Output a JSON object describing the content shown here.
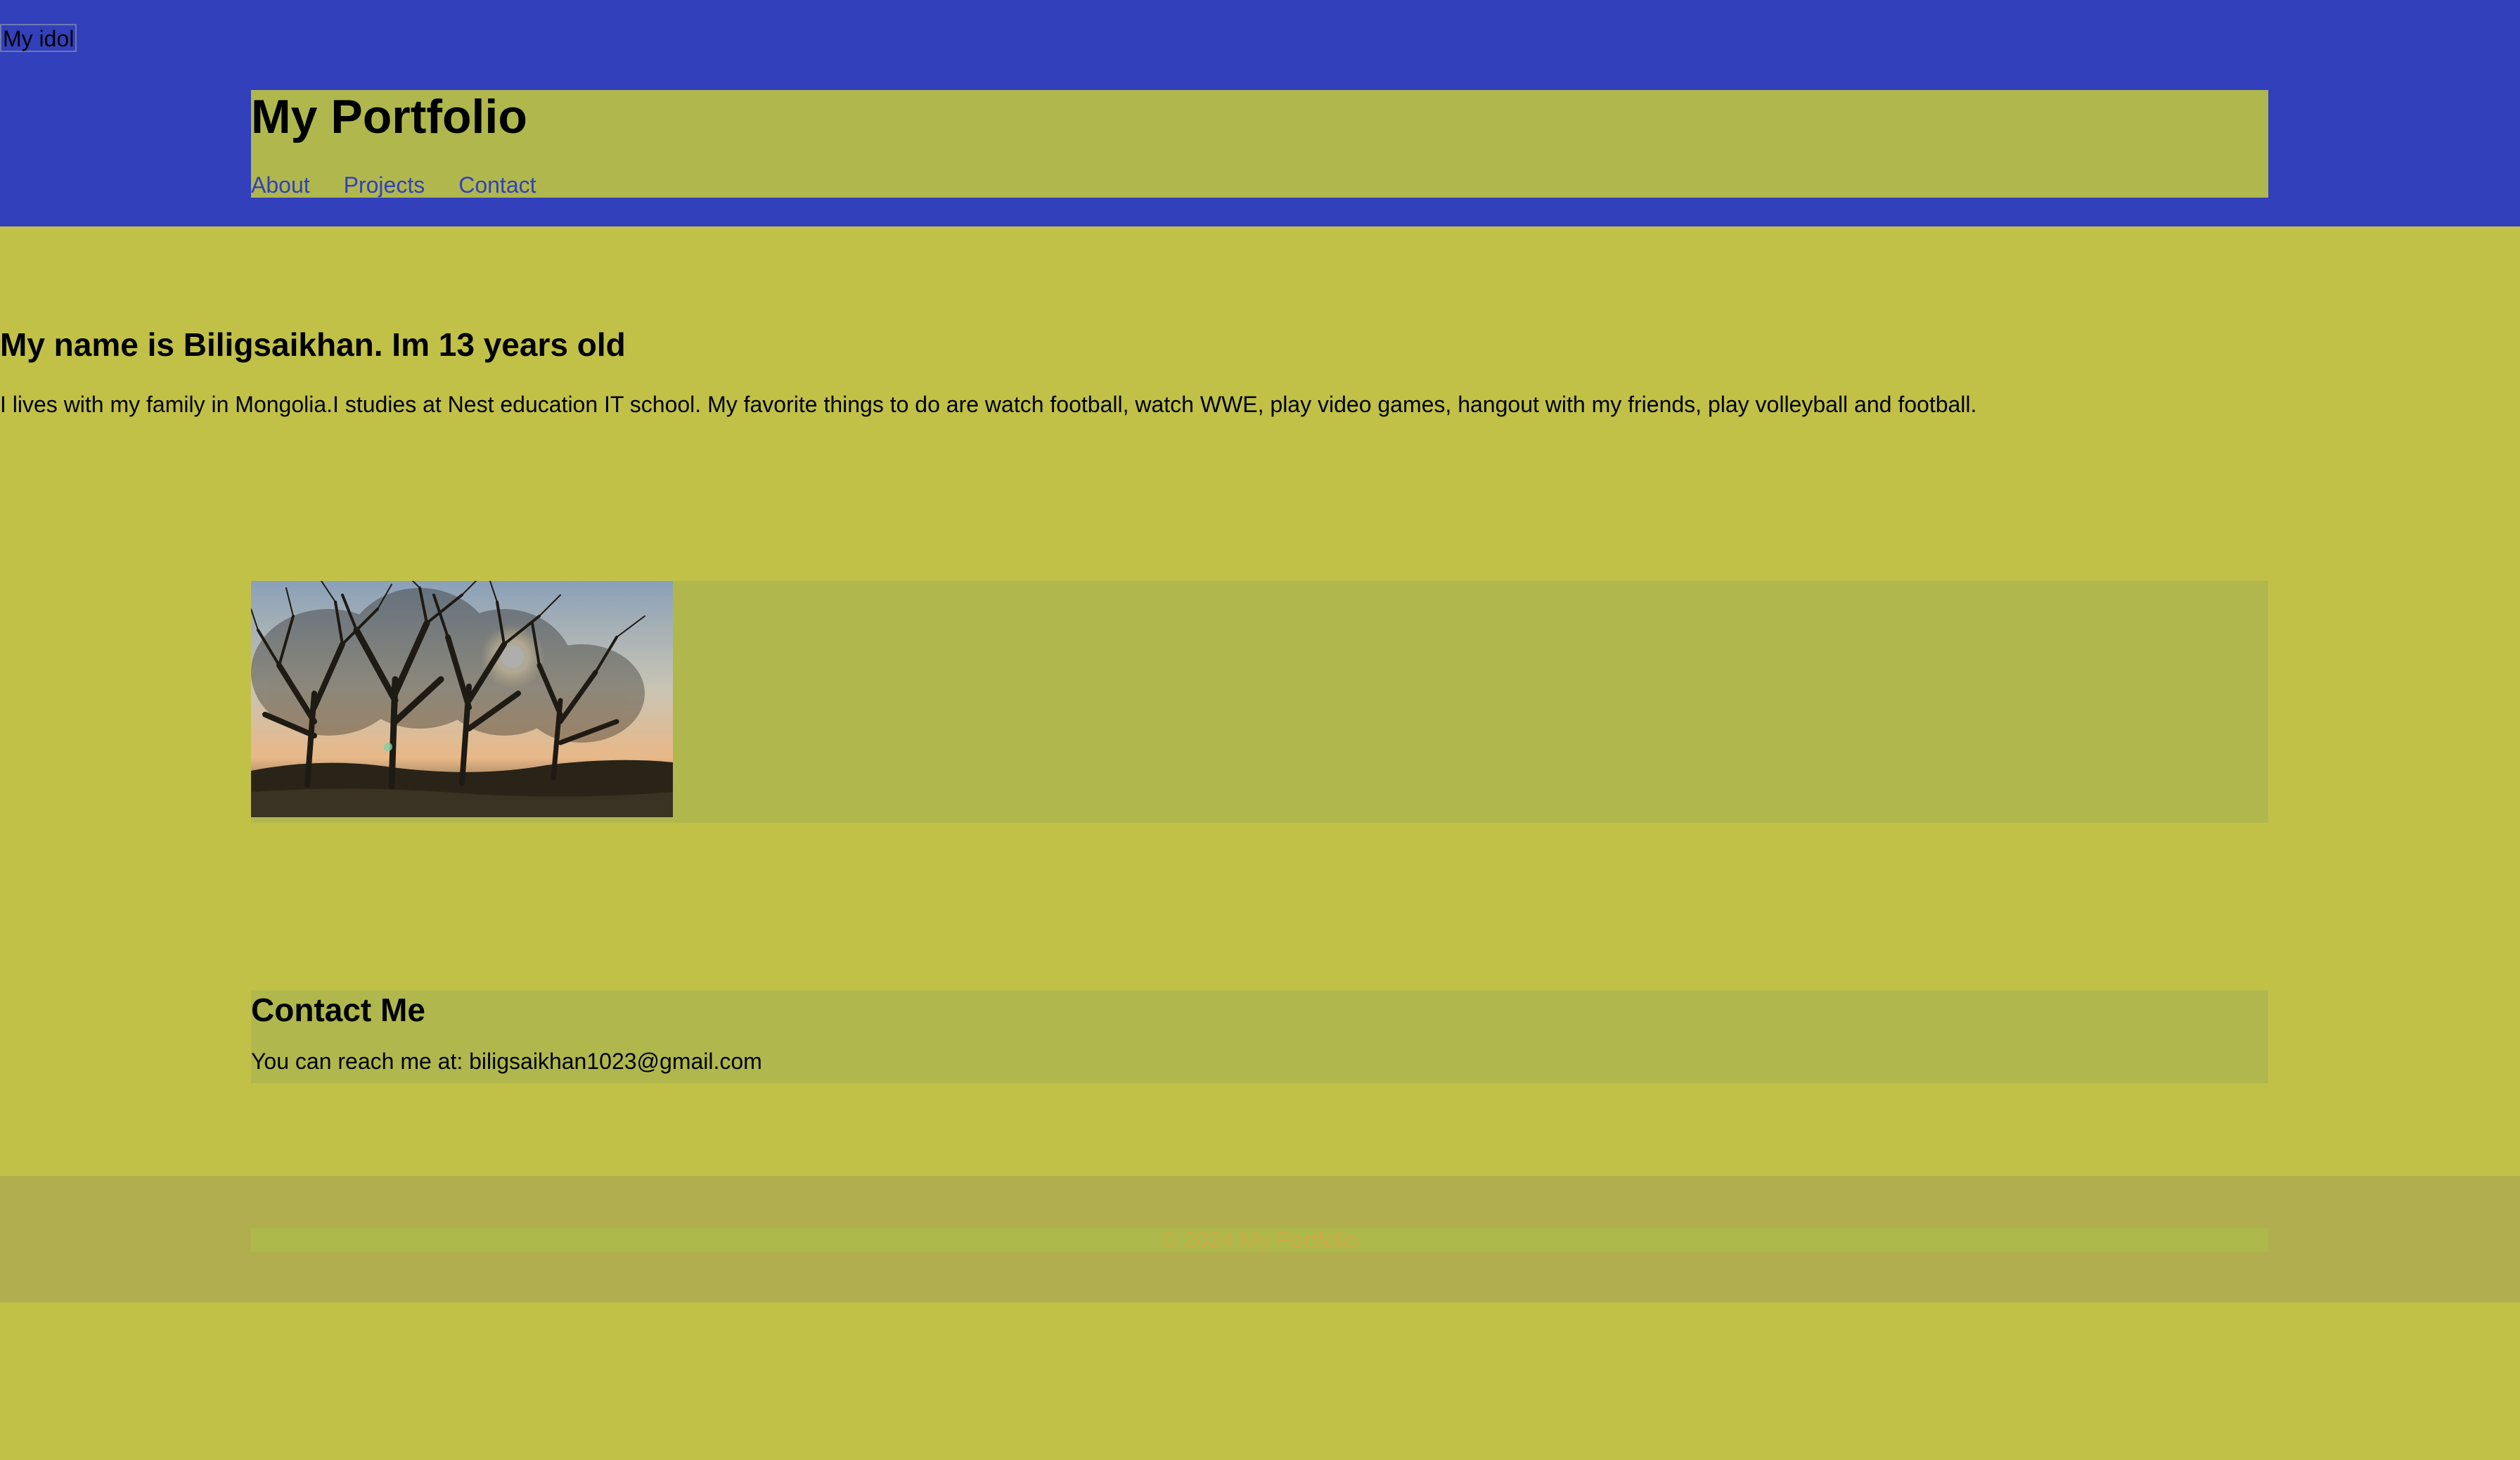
{
  "colors": {
    "page_background": "#c1c148",
    "top_bar": "#3240bc",
    "panel": "#b0b84d",
    "link": "#3240bc",
    "footer_background": "#b0ae4f",
    "footer_text": "#c9aa45"
  },
  "idol_button": {
    "label": "My idol"
  },
  "header": {
    "title": "My Portfolio",
    "nav": [
      {
        "label": "About"
      },
      {
        "label": "Projects"
      },
      {
        "label": "Contact"
      }
    ]
  },
  "intro": {
    "heading": "My name is Biligsaikhan. Im 13 years old",
    "text": "I lives with my family in Mongolia.I studies at Nest education IT school. My favorite things to do are watch football, watch WWE, play video games, hangout with my friends, play volleyball and football."
  },
  "gallery": {
    "image_description": "tree-silhouette-sunset-photo"
  },
  "contact": {
    "heading": "Contact Me",
    "text": "You can reach me at: biligsaikhan1023@gmail.com"
  },
  "footer": {
    "text": "© 2024 My Portfolio"
  }
}
